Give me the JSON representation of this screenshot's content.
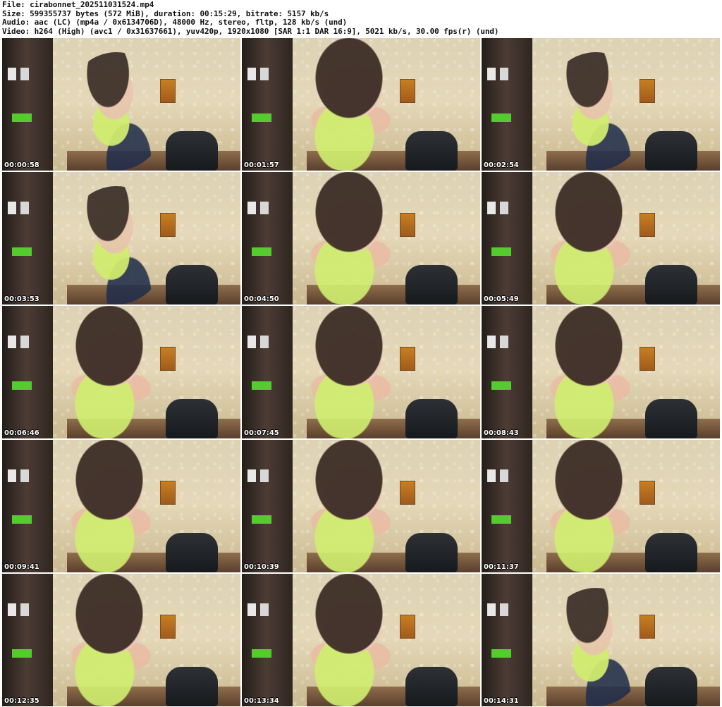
{
  "header": {
    "file": "File: cirabonnet_202511031524.mp4",
    "size": "Size: 599355737 bytes (572 MiB), duration: 00:15:29, bitrate: 5157 kb/s",
    "audio": "Audio: aac (LC) (mp4a / 0x6134706D), 48000 Hz, stereo, fltp, 128 kb/s (und)",
    "video": "Video: h264 (High) (avc1 / 0x31637661), yuv420p, 1920x1080 [SAR 1:1 DAR 16:9], 5021 kb/s, 30.00 fps(r) (und)"
  },
  "thumbnails": [
    {
      "timestamp": "00:00:58"
    },
    {
      "timestamp": "00:01:57"
    },
    {
      "timestamp": "00:02:54"
    },
    {
      "timestamp": "00:03:53"
    },
    {
      "timestamp": "00:04:50"
    },
    {
      "timestamp": "00:05:49"
    },
    {
      "timestamp": "00:06:46"
    },
    {
      "timestamp": "00:07:45"
    },
    {
      "timestamp": "00:08:43"
    },
    {
      "timestamp": "00:09:41"
    },
    {
      "timestamp": "00:10:39"
    },
    {
      "timestamp": "00:11:37"
    },
    {
      "timestamp": "00:12:35"
    },
    {
      "timestamp": "00:13:34"
    },
    {
      "timestamp": "00:14:31"
    }
  ]
}
